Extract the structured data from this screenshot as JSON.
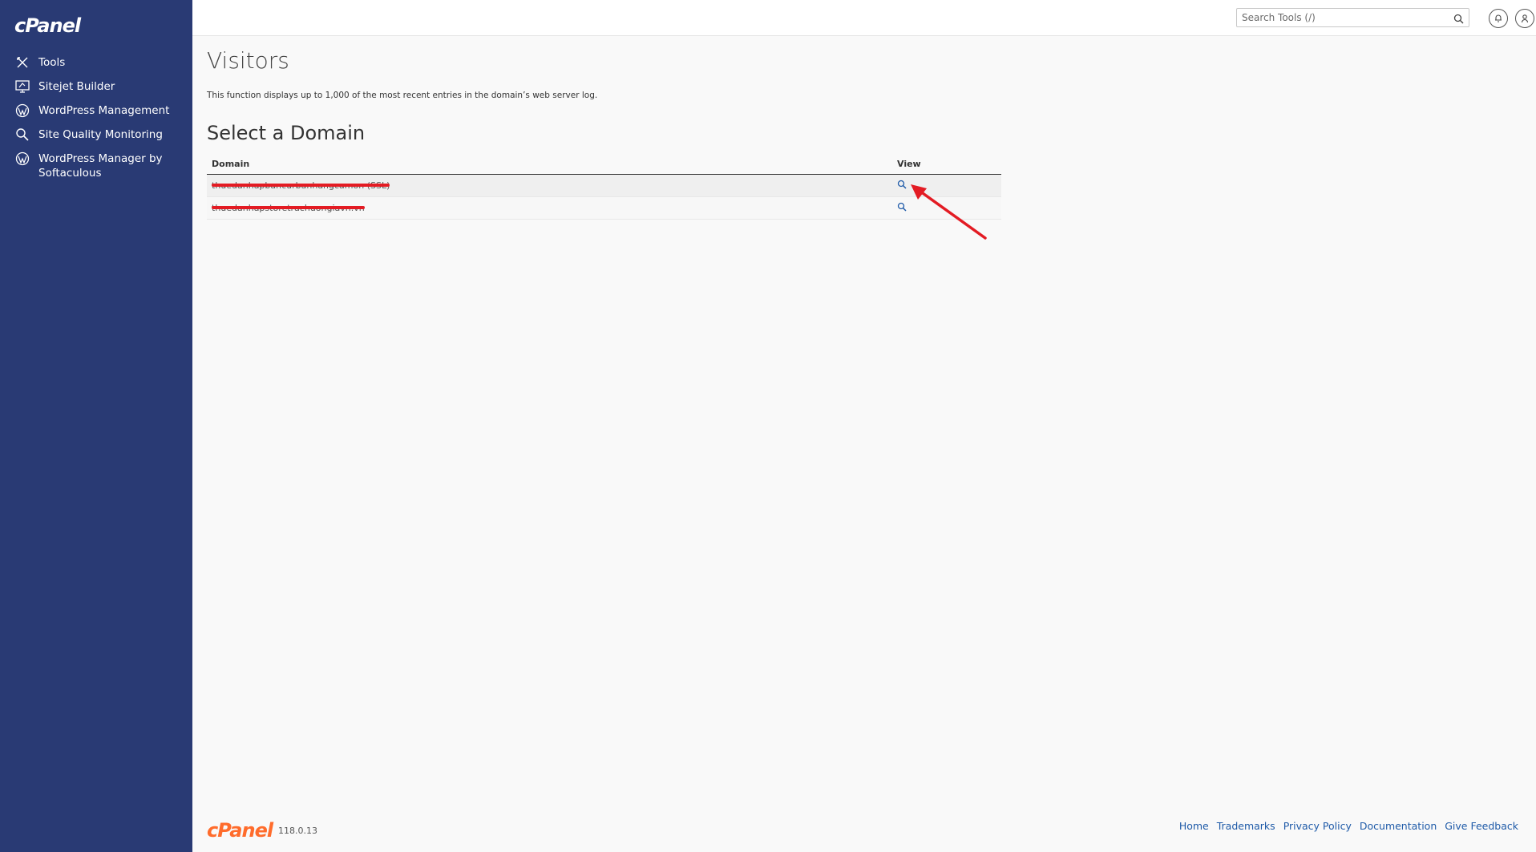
{
  "sidebar": {
    "logo": "cPanel",
    "items": [
      {
        "label": "Tools",
        "icon": "tools-icon"
      },
      {
        "label": "Sitejet Builder",
        "icon": "sitejet-icon"
      },
      {
        "label": "WordPress Management",
        "icon": "wordpress-icon"
      },
      {
        "label": "Site Quality Monitoring",
        "icon": "magnifier-icon"
      },
      {
        "label": "WordPress Manager by Softaculous",
        "icon": "wordpress-icon"
      }
    ]
  },
  "header": {
    "search_placeholder": "Search Tools (/)"
  },
  "main": {
    "title": "Visitors",
    "description": "This function displays up to 1,000 of the most recent entries in the domain’s web server log.",
    "section_title": "Select a Domain",
    "table": {
      "columns": [
        "Domain",
        "View"
      ],
      "rows": [
        {
          "domain": "thuedanhapbancurbanhangcamon (SSL)"
        },
        {
          "domain": "thuedanhapstoretrachuongiavn.vn"
        }
      ]
    }
  },
  "footer": {
    "logo": "cPanel",
    "version": "118.0.13",
    "links": [
      "Home",
      "Trademarks",
      "Privacy Policy",
      "Documentation",
      "Give Feedback"
    ]
  },
  "colors": {
    "sidebar_bg": "#293a74",
    "accent": "#ff6c2c",
    "link": "#1e5aa8",
    "annotation": "#e31b23"
  }
}
